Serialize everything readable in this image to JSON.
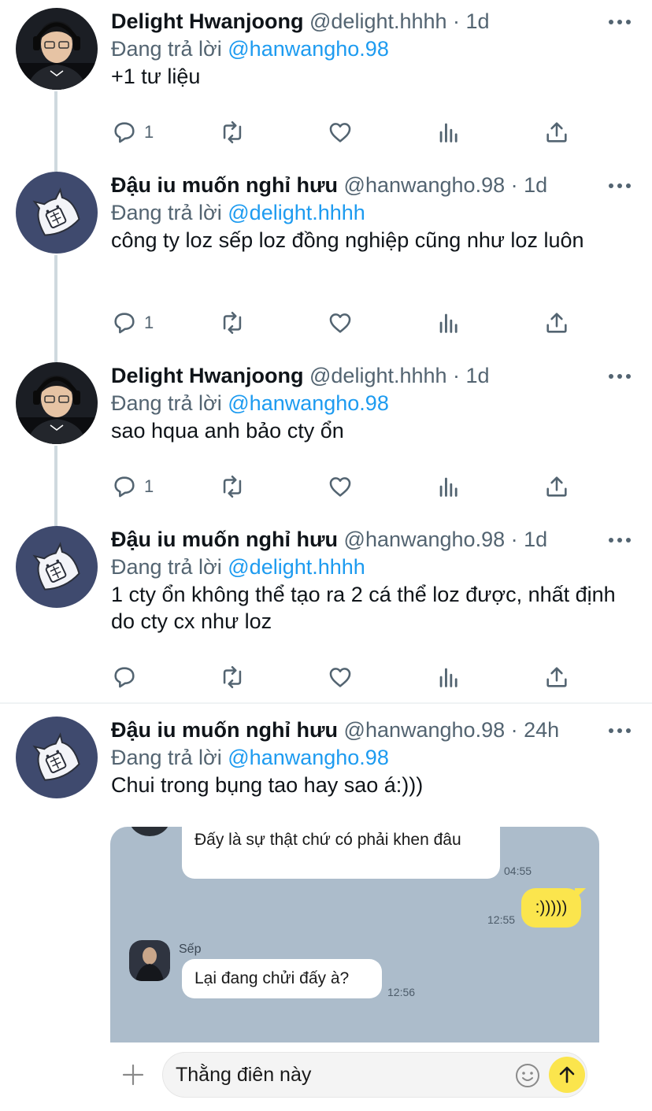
{
  "tweets": [
    {
      "name": "Delight Hwanjoong",
      "meta": "@delight.hhhh · 1d",
      "reply_prefix": "Đang trả lời ",
      "reply_to": "@hanwangho.98",
      "text": "+1 tư liệu",
      "reply_count": "1",
      "avatar": "photo-person-headset"
    },
    {
      "name": "Đậu iu muốn nghỉ hưu",
      "meta": "@hanwangho.98 · 1d",
      "reply_prefix": "Đang trả lời ",
      "reply_to": "@delight.hhhh",
      "text": "công ty loz sếp loz đồng nghiệp cũng như loz luôn",
      "reply_count": "1",
      "avatar": "cat-sticker"
    },
    {
      "name": "Delight Hwanjoong",
      "meta": "@delight.hhhh · 1d",
      "reply_prefix": "Đang trả lời ",
      "reply_to": "@hanwangho.98",
      "text": "sao hqua anh bảo cty ổn",
      "reply_count": "1",
      "avatar": "photo-person-headset"
    },
    {
      "name": "Đậu iu muốn nghỉ hưu",
      "meta": "@hanwangho.98 · 1d",
      "reply_prefix": "Đang trả lời ",
      "reply_to": "@delight.hhhh",
      "text": "1 cty ổn không thể tạo ra 2 cá thể loz được, nhất định do cty cx như loz",
      "reply_count": "",
      "avatar": "cat-sticker"
    },
    {
      "name": "Đậu iu muốn nghỉ hưu",
      "meta": "@hanwangho.98 · 24h",
      "reply_prefix": "Đang trả lời ",
      "reply_to": "@hanwangho.98",
      "text": "Chui trong bụng tao hay sao á:)))",
      "reply_count": "",
      "avatar": "cat-sticker"
    }
  ],
  "chat": {
    "msg1": "Đấy là sự thật chứ có phải khen đâu",
    "time1": "04:55",
    "msg2": ":)))))",
    "time2": "12:55",
    "sender": "Sếp",
    "msg3": "Lại đang chửi đấy à?",
    "time3": "12:56",
    "input_text": "Thằng điên này"
  },
  "icons": [
    "reply-icon",
    "retweet-icon",
    "like-icon",
    "views-icon",
    "share-icon",
    "more-icon",
    "plus-icon",
    "emoji-icon",
    "send-icon"
  ],
  "colors": {
    "link": "#1d9bf0",
    "muted": "#536471",
    "chat_bg": "#acbccb",
    "bubble_out": "#fbe54d"
  }
}
